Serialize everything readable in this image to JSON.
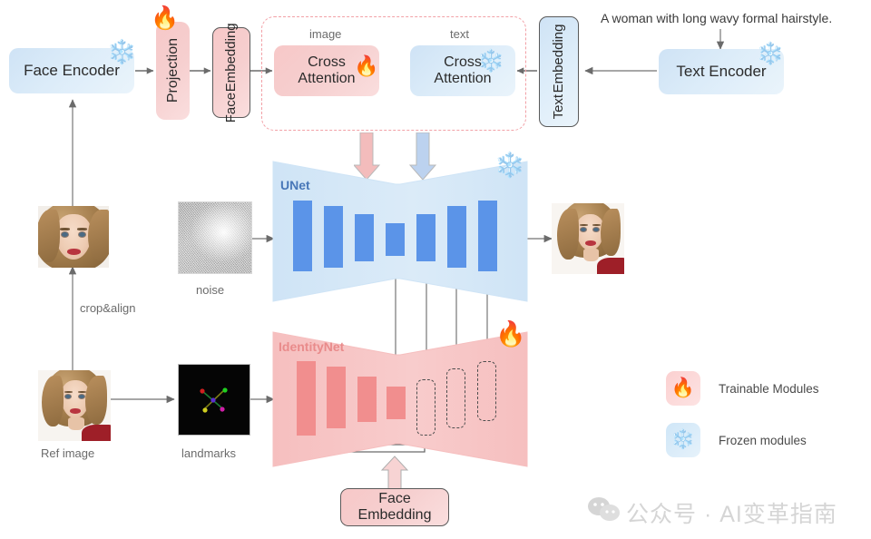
{
  "diagram": {
    "title": "InstantID pipeline diagram",
    "colors": {
      "trainable_pink": "#f2a0a6",
      "frozen_blue": "#a9cfec",
      "bar_blue": "#5b94e8",
      "bar_pink": "#f18e8e",
      "unet_fill": "#d3e6f7",
      "identitynet_fill": "#f6c1c1",
      "arrow_gray": "#6b6b6b",
      "label_gray": "#6b6b6b",
      "watermark_gray": "#d5d5d5"
    }
  },
  "top_row": {
    "face_encoder": {
      "label": "Face Encoder",
      "icon": "snowflake-icon",
      "state": "frozen"
    },
    "projection": {
      "label": "Projection",
      "icon": "fire-icon",
      "state": "trainable"
    },
    "face_embedding": {
      "label": "Face\nEmbedding",
      "line1": "Face",
      "line2": "Embedding",
      "state": "trainable"
    },
    "text_embedding": {
      "line1": "Text",
      "line2": "Embedding",
      "state": "frozen"
    },
    "text_encoder": {
      "label": "Text Encoder",
      "icon": "snowflake-icon",
      "state": "frozen"
    },
    "prompt": "A woman with long wavy formal hairstyle."
  },
  "attention_group": {
    "image_caption": "image",
    "text_caption": "text",
    "image_cross_attention": {
      "line1": "Cross",
      "line2": "Attention",
      "icon": "fire-icon",
      "state": "trainable"
    },
    "text_cross_attention": {
      "line1": "Cross",
      "line2": "Attention",
      "icon": "snowflake-icon",
      "state": "frozen"
    }
  },
  "unet": {
    "label": "UNet",
    "icon": "snowflake-icon",
    "state": "frozen",
    "blocks": 7
  },
  "identitynet": {
    "label": "IdentityNet",
    "icon": "fire-icon",
    "state": "trainable",
    "blocks": 4,
    "dashed_blocks": 3,
    "face_embedding": {
      "line1": "Face",
      "line2": "Embedding"
    }
  },
  "left_column": {
    "cropped_face_caption": "",
    "crop_align_label": "crop&align",
    "ref_image_label": "Ref image",
    "noise_label": "noise",
    "landmarks_label": "landmarks"
  },
  "legend": {
    "items": [
      {
        "icon": "fire-icon",
        "label": "Trainable Modules",
        "swatch": "pink"
      },
      {
        "icon": "snowflake-icon",
        "label": "Frozen modules",
        "swatch": "blue"
      }
    ]
  },
  "watermark": {
    "icon": "wechat-icon",
    "text": "公众号 · AI变革指南"
  }
}
